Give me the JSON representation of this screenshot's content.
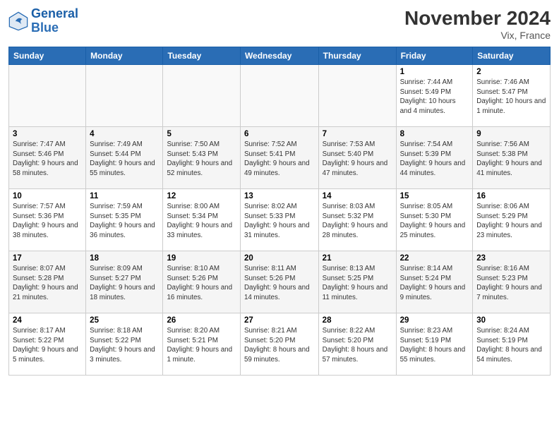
{
  "header": {
    "logo_general": "General",
    "logo_blue": "Blue",
    "month_title": "November 2024",
    "location": "Vix, France"
  },
  "days_of_week": [
    "Sunday",
    "Monday",
    "Tuesday",
    "Wednesday",
    "Thursday",
    "Friday",
    "Saturday"
  ],
  "weeks": [
    [
      {
        "day": "",
        "info": ""
      },
      {
        "day": "",
        "info": ""
      },
      {
        "day": "",
        "info": ""
      },
      {
        "day": "",
        "info": ""
      },
      {
        "day": "",
        "info": ""
      },
      {
        "day": "1",
        "info": "Sunrise: 7:44 AM\nSunset: 5:49 PM\nDaylight: 10 hours and 4 minutes."
      },
      {
        "day": "2",
        "info": "Sunrise: 7:46 AM\nSunset: 5:47 PM\nDaylight: 10 hours and 1 minute."
      }
    ],
    [
      {
        "day": "3",
        "info": "Sunrise: 7:47 AM\nSunset: 5:46 PM\nDaylight: 9 hours and 58 minutes."
      },
      {
        "day": "4",
        "info": "Sunrise: 7:49 AM\nSunset: 5:44 PM\nDaylight: 9 hours and 55 minutes."
      },
      {
        "day": "5",
        "info": "Sunrise: 7:50 AM\nSunset: 5:43 PM\nDaylight: 9 hours and 52 minutes."
      },
      {
        "day": "6",
        "info": "Sunrise: 7:52 AM\nSunset: 5:41 PM\nDaylight: 9 hours and 49 minutes."
      },
      {
        "day": "7",
        "info": "Sunrise: 7:53 AM\nSunset: 5:40 PM\nDaylight: 9 hours and 47 minutes."
      },
      {
        "day": "8",
        "info": "Sunrise: 7:54 AM\nSunset: 5:39 PM\nDaylight: 9 hours and 44 minutes."
      },
      {
        "day": "9",
        "info": "Sunrise: 7:56 AM\nSunset: 5:38 PM\nDaylight: 9 hours and 41 minutes."
      }
    ],
    [
      {
        "day": "10",
        "info": "Sunrise: 7:57 AM\nSunset: 5:36 PM\nDaylight: 9 hours and 38 minutes."
      },
      {
        "day": "11",
        "info": "Sunrise: 7:59 AM\nSunset: 5:35 PM\nDaylight: 9 hours and 36 minutes."
      },
      {
        "day": "12",
        "info": "Sunrise: 8:00 AM\nSunset: 5:34 PM\nDaylight: 9 hours and 33 minutes."
      },
      {
        "day": "13",
        "info": "Sunrise: 8:02 AM\nSunset: 5:33 PM\nDaylight: 9 hours and 31 minutes."
      },
      {
        "day": "14",
        "info": "Sunrise: 8:03 AM\nSunset: 5:32 PM\nDaylight: 9 hours and 28 minutes."
      },
      {
        "day": "15",
        "info": "Sunrise: 8:05 AM\nSunset: 5:30 PM\nDaylight: 9 hours and 25 minutes."
      },
      {
        "day": "16",
        "info": "Sunrise: 8:06 AM\nSunset: 5:29 PM\nDaylight: 9 hours and 23 minutes."
      }
    ],
    [
      {
        "day": "17",
        "info": "Sunrise: 8:07 AM\nSunset: 5:28 PM\nDaylight: 9 hours and 21 minutes."
      },
      {
        "day": "18",
        "info": "Sunrise: 8:09 AM\nSunset: 5:27 PM\nDaylight: 9 hours and 18 minutes."
      },
      {
        "day": "19",
        "info": "Sunrise: 8:10 AM\nSunset: 5:26 PM\nDaylight: 9 hours and 16 minutes."
      },
      {
        "day": "20",
        "info": "Sunrise: 8:11 AM\nSunset: 5:26 PM\nDaylight: 9 hours and 14 minutes."
      },
      {
        "day": "21",
        "info": "Sunrise: 8:13 AM\nSunset: 5:25 PM\nDaylight: 9 hours and 11 minutes."
      },
      {
        "day": "22",
        "info": "Sunrise: 8:14 AM\nSunset: 5:24 PM\nDaylight: 9 hours and 9 minutes."
      },
      {
        "day": "23",
        "info": "Sunrise: 8:16 AM\nSunset: 5:23 PM\nDaylight: 9 hours and 7 minutes."
      }
    ],
    [
      {
        "day": "24",
        "info": "Sunrise: 8:17 AM\nSunset: 5:22 PM\nDaylight: 9 hours and 5 minutes."
      },
      {
        "day": "25",
        "info": "Sunrise: 8:18 AM\nSunset: 5:22 PM\nDaylight: 9 hours and 3 minutes."
      },
      {
        "day": "26",
        "info": "Sunrise: 8:20 AM\nSunset: 5:21 PM\nDaylight: 9 hours and 1 minute."
      },
      {
        "day": "27",
        "info": "Sunrise: 8:21 AM\nSunset: 5:20 PM\nDaylight: 8 hours and 59 minutes."
      },
      {
        "day": "28",
        "info": "Sunrise: 8:22 AM\nSunset: 5:20 PM\nDaylight: 8 hours and 57 minutes."
      },
      {
        "day": "29",
        "info": "Sunrise: 8:23 AM\nSunset: 5:19 PM\nDaylight: 8 hours and 55 minutes."
      },
      {
        "day": "30",
        "info": "Sunrise: 8:24 AM\nSunset: 5:19 PM\nDaylight: 8 hours and 54 minutes."
      }
    ]
  ]
}
